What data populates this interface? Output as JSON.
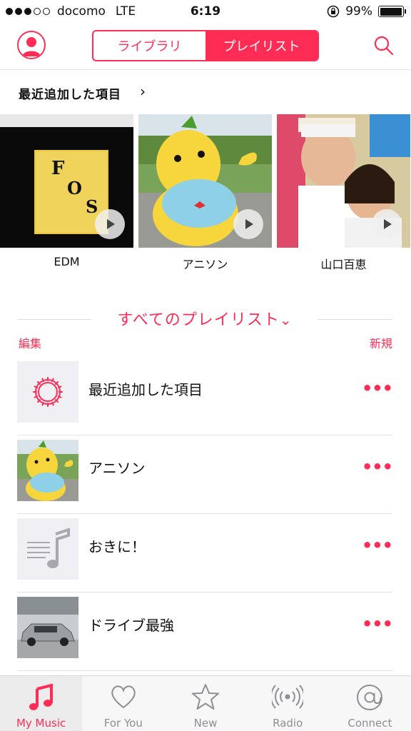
{
  "status_bar": {
    "carrier": "docomo",
    "network": "LTE",
    "time": "6:19",
    "battery_percent": "99%",
    "battery_level": 0.99,
    "signal_bars_filled": 3,
    "signal_bars_total": 5
  },
  "nav": {
    "segments": [
      "ライブラリ",
      "プレイリスト"
    ],
    "active_segment": "プレイリスト",
    "avatar_icon": "person-icon",
    "search_icon": "search-icon"
  },
  "recent": {
    "title": "最近追加した項目",
    "chevron": "›",
    "albums": [
      {
        "label": "EDM",
        "art_text": [
          "F",
          "O",
          "S"
        ]
      },
      {
        "label": "アニソン"
      },
      {
        "label": "山口百恵"
      }
    ]
  },
  "all_playlists": {
    "title": "すべてのプレイリスト",
    "chevron": "⌄",
    "edit": "編集",
    "new": "新規",
    "items": [
      {
        "name": "最近追加した項目",
        "more": "•••",
        "thumb": "gear-icon"
      },
      {
        "name": "アニソン",
        "more": "•••",
        "thumb": "mascot-photo"
      },
      {
        "name": "おきに！",
        "more": "•••",
        "thumb": "music-note-icon"
      },
      {
        "name": "ドライブ最強",
        "more": "•••",
        "thumb": "car-photo"
      }
    ]
  },
  "tab_bar": {
    "tabs": [
      {
        "label": "My Music",
        "icon": "music-note-icon",
        "active": true
      },
      {
        "label": "For You",
        "icon": "heart-icon",
        "active": false
      },
      {
        "label": "New",
        "icon": "star-icon",
        "active": false
      },
      {
        "label": "Radio",
        "icon": "radio-icon",
        "active": false
      },
      {
        "label": "Connect",
        "icon": "at-icon",
        "active": false
      }
    ]
  },
  "colors": {
    "accent": "#ff2d55",
    "inactive": "#8e8e93"
  }
}
